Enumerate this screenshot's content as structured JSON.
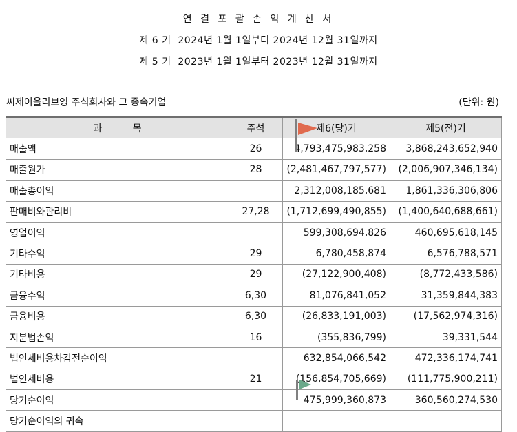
{
  "header": {
    "title": "연 결 포 괄 손 익 계 산 서",
    "period_current": "제 6 기  2024년 1월 1일부터 2024년 12월 31일까지",
    "period_prior": "제 5 기  2023년 1월 1일부터 2023년 12월 31일까지",
    "company": "씨제이올리브영 주식회사와 그 종속기업",
    "unit": "(단위: 원)"
  },
  "table": {
    "columns": {
      "item": "과          목",
      "note": "주석",
      "current": "제6(당)기",
      "prior": "제5(전)기"
    },
    "rows": [
      {
        "item": "매출액",
        "note": "26",
        "current": "4,793,475,983,258",
        "prior": "3,868,243,652,940"
      },
      {
        "item": "매출원가",
        "note": "28",
        "current": "(2,481,467,797,577)",
        "prior": "(2,006,907,346,134)"
      },
      {
        "item": "매출총이익",
        "note": "",
        "current": "2,312,008,185,681",
        "prior": "1,861,336,306,806"
      },
      {
        "item": "판매비와관리비",
        "note": "27,28",
        "current": "(1,712,699,490,855)",
        "prior": "(1,400,640,688,661)"
      },
      {
        "item": "영업이익",
        "note": "",
        "current": "599,308,694,826",
        "prior": "460,695,618,145"
      },
      {
        "item": "기타수익",
        "note": "29",
        "current": "6,780,458,874",
        "prior": "6,576,788,571"
      },
      {
        "item": "기타비용",
        "note": "29",
        "current": "(27,122,900,408)",
        "prior": "(8,772,433,586)"
      },
      {
        "item": "금융수익",
        "note": "6,30",
        "current": "81,076,841,052",
        "prior": "31,359,844,383"
      },
      {
        "item": "금융비용",
        "note": "6,30",
        "current": "(26,833,191,003)",
        "prior": "(17,562,974,316)"
      },
      {
        "item": "지분법손익",
        "note": "16",
        "current": "(355,836,799)",
        "prior": "39,331,544"
      },
      {
        "item": "법인세비용차감전순이익",
        "note": "",
        "current": "632,854,066,542",
        "prior": "472,336,174,741"
      },
      {
        "item": "법인세비용",
        "note": "21",
        "current": "(156,854,705,669)",
        "prior": "(111,775,900,211)"
      },
      {
        "item": "당기순이익",
        "note": "",
        "current": "475,999,360,873",
        "prior": "360,560,274,530"
      },
      {
        "item": "당기순이익의 귀속",
        "note": "",
        "current": "",
        "prior": ""
      }
    ]
  },
  "markers": {
    "red_flag_color": "#e06a4e",
    "green_flag_color": "#6aa88a",
    "pole_color": "#808080"
  }
}
